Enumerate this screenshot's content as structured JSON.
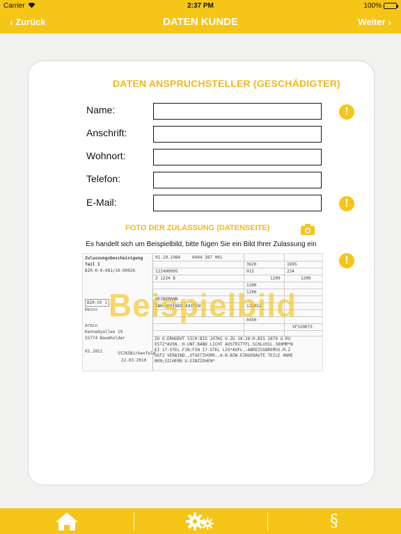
{
  "status_bar": {
    "carrier": "Carrier",
    "time": "2:37 PM",
    "battery": "100%"
  },
  "nav": {
    "back_label": "Zurück",
    "title": "DATEN KUNDE",
    "next_label": "Weiter"
  },
  "form": {
    "section_title": "DATEN ANSPRUCHSTELLER (GESCHÄDIGTER)",
    "fields": [
      {
        "label": "Name:",
        "value": ""
      },
      {
        "label": "Anschrift:",
        "value": ""
      },
      {
        "label": "Wohnort:",
        "value": ""
      },
      {
        "label": "Telefon:",
        "value": ""
      },
      {
        "label": "E-Mail:",
        "value": ""
      }
    ]
  },
  "photo": {
    "title": "FOTO DER ZULASSUNG (DATENSEITE)",
    "hint": "Es handelt sich um Beispielbild, bitte fügen Sie ein Bild Ihrer Zulassung ein",
    "watermark": "Beispielbild",
    "doc": {
      "header": "Zulassungsbescheinigung Teil I",
      "reg": "BIR-K-0-081/10-00026",
      "owner_name": "Heinz",
      "first_name": "Armin",
      "street": "Kennedyallee 19",
      "city": "55774 Baumholder",
      "place": "55765Birkenfeld",
      "date1": "02.2011",
      "date2": "22.03.2010",
      "plate": "BIR-SV 1",
      "c_date": "01.10.1984",
      "c_codes": "0404  387  001",
      "c_num": "122400095",
      "make": "HEINEMANN",
      "body": "ANH.OFFENER KASTEN",
      "type": "Z 1224 B",
      "v1": "3620",
      "v2": "1695",
      "v3": "915",
      "v4": "234",
      "v5": "1200",
      "v6": "1200",
      "v7": "1200",
      "v8": "1200",
      "v9": "12SM14",
      "v10": "0450",
      "v11": "VF320075",
      "remarks1": "ZU G:ERHOEHT SICH:BIS 107KG  U.ZU 18-20:H.BIS 2870 U.RU",
      "remarks2": "ESTZ*AUSN.:H.UNT.RAND LICHT AUSTRITTFL.SCHLUSSL.380MM*B",
      "remarks3": "EI 17-STEL.FIN:FIN 17-STEL LIG*AUFL.:ABREISSBREMSS.M.Z",
      "remarks4": "UGFZ VERBIND.,STUETZVORR.,A-N-BZW.EINGEBAUTE TEILE ANHE",
      "remarks5": "BEN;SICHERN U.EINZIEHEN*"
    }
  },
  "icons": {
    "warning": "!",
    "camera": "camera-icon",
    "home": "home-icon",
    "settings": "gears-icon",
    "legal": "§"
  },
  "colors": {
    "accent": "#f5c518",
    "title_text": "#f0b81a",
    "background": "#f1f1ef"
  }
}
